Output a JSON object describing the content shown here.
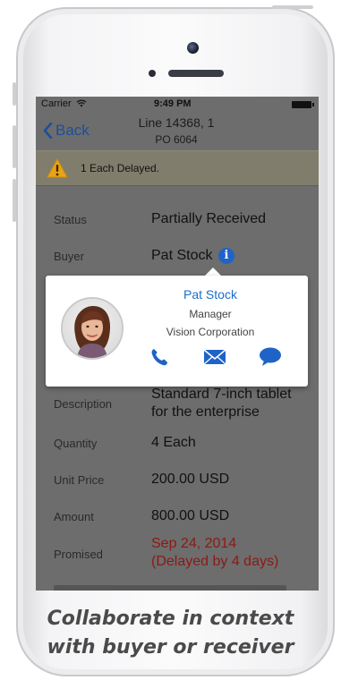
{
  "status_bar": {
    "carrier": "Carrier",
    "time": "9:49 PM"
  },
  "nav": {
    "back_label": "Back",
    "title_line1": "Line 14368, 1",
    "title_line2": "PO 6064"
  },
  "alert": {
    "icon": "warning-icon",
    "text": "1 Each Delayed."
  },
  "fields": {
    "status": {
      "label": "Status",
      "value": "Partially Received"
    },
    "buyer": {
      "label": "Buyer",
      "value": "Pat Stock"
    },
    "description": {
      "label": "Description",
      "value": "Standard 7-inch tablet for the enterprise"
    },
    "quantity": {
      "label": "Quantity",
      "value": "4 Each"
    },
    "unit_price": {
      "label": "Unit Price",
      "value": "200.00 USD"
    },
    "amount": {
      "label": "Amount",
      "value": "800.00 USD"
    },
    "promised": {
      "label": "Promised",
      "value_line1": "Sep 24, 2014",
      "value_line2": "(Delayed by 4 days)"
    }
  },
  "contact_card": {
    "name": "Pat Stock",
    "title": "Manager",
    "organization": "Vision Corporation",
    "actions": [
      "phone-icon",
      "email-icon",
      "chat-icon"
    ]
  },
  "caption": {
    "line1": "Collaborate in context",
    "line2": "with buyer or receiver"
  },
  "colors": {
    "link_blue": "#1a4f9c",
    "name_blue": "#1a6fc9",
    "action_blue": "#1f63c7",
    "delayed_red": "#8b1a14",
    "overlay_gray": "#6d6d6d",
    "warning_yellow": "#e8a317"
  }
}
